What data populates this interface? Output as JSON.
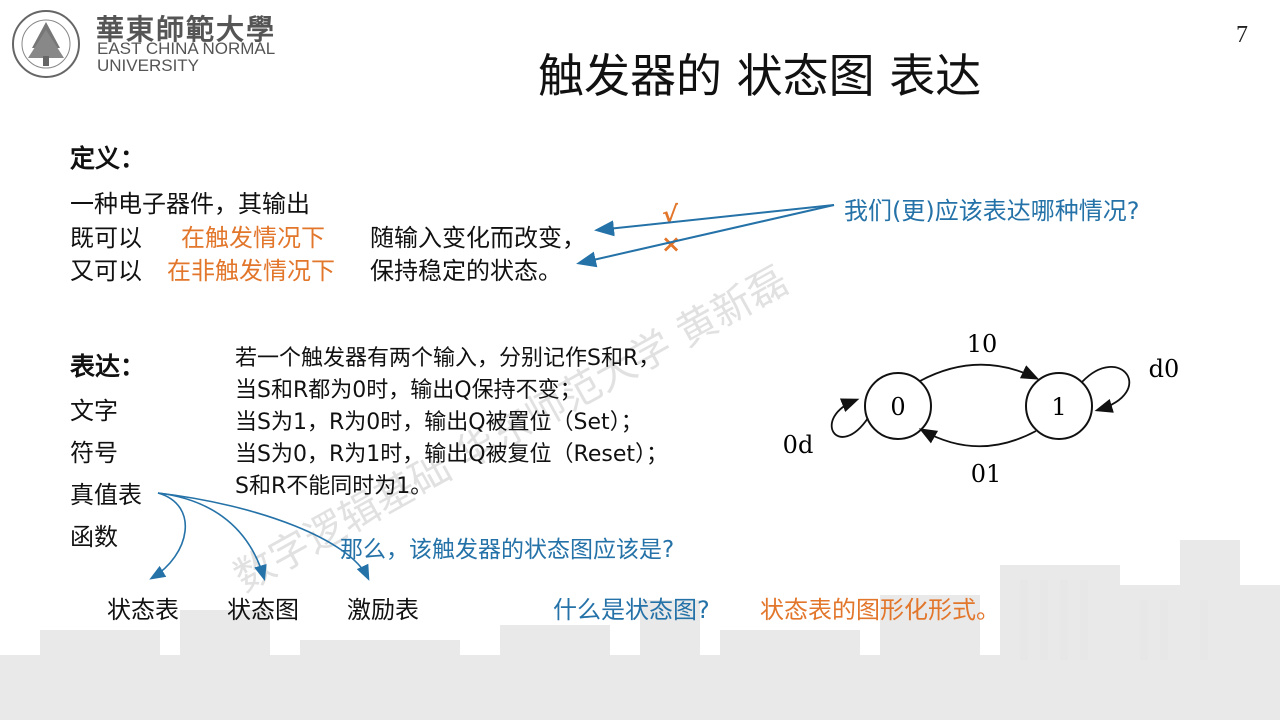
{
  "header": {
    "logo_cn": "華東師範大學",
    "logo_en_line1": "EAST CHINA NORMAL",
    "logo_en_line2": "UNIVERSITY",
    "page_number": "7"
  },
  "title": "触发器的 状态图 表达",
  "definition": {
    "heading": "定义：",
    "line1": "一种电子器件，其输出",
    "line2_prefix": "既可以",
    "line2_highlight": "在触发情况下",
    "line2_suffix": "随输入变化而改变，",
    "line3_prefix": "又可以",
    "line3_highlight": "在非触发情况下",
    "line3_suffix": "保持稳定的状态。",
    "question": "我们(更)应该表达哪种情况?",
    "check_mark": "√",
    "cross_mark": "×"
  },
  "expression": {
    "heading": "表达：",
    "items": [
      "文字",
      "符号",
      "真值表",
      "函数"
    ],
    "explanation": [
      "若一个触发器有两个输入，分别记作S和R，",
      "当S和R都为0时，输出Q保持不变；",
      "当S为1，R为0时，输出Q被置位（Set）；",
      "当S为0，R为1时，输出Q被复位（Reset）；",
      "S和R不能同时为1。"
    ],
    "question": "那么，该触发器的状态图应该是?",
    "forms": [
      "状态表",
      "状态图",
      "激励表"
    ],
    "what_is_question": "什么是状态图?",
    "what_is_answer": "状态表的图形化形式。"
  },
  "state_diagram": {
    "states": [
      "0",
      "1"
    ],
    "transitions": [
      {
        "from": "0",
        "to": "1",
        "label": "10"
      },
      {
        "from": "1",
        "to": "0",
        "label": "01"
      },
      {
        "from": "0",
        "to": "0",
        "label": "0d"
      },
      {
        "from": "1",
        "to": "1",
        "label": "d0"
      }
    ]
  },
  "watermark": "数字逻辑基础  华东师范大学 黄新磊",
  "colors": {
    "accent_orange": "#e2762b",
    "accent_blue": "#2472a8"
  }
}
